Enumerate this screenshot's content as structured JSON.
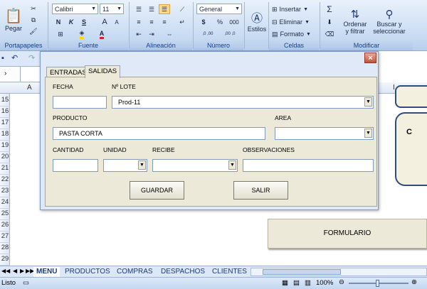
{
  "ribbon": {
    "clipboard": {
      "paste": "Pegar",
      "group": "Portapapeles"
    },
    "font": {
      "name": "Calibri",
      "size": "11",
      "bold": "N",
      "italic": "K",
      "underline": "S",
      "grow": "A",
      "shrink": "A",
      "font_color": "A",
      "group": "Fuente"
    },
    "alignment": {
      "group": "Alineación"
    },
    "number": {
      "format": "General",
      "currency": "$",
      "percent": "%",
      "thousands": "000",
      "inc_decimals": ",0 ,00",
      "dec_decimals": ",00 ,0",
      "group": "Número"
    },
    "styles": {
      "label": "Estilos"
    },
    "cells": {
      "insert": "Insertar",
      "delete": "Eliminar",
      "format": "Formato",
      "group": "Celdas"
    },
    "modify": {
      "sum": "Σ",
      "sort": "Ordenar\ny filtrar",
      "find": "Buscar y\nseleccionar",
      "group": "Modificar"
    }
  },
  "grid": {
    "column_a": "A",
    "column_i": "I",
    "rows": [
      "15",
      "16",
      "17",
      "18",
      "19",
      "20",
      "21",
      "22",
      "23",
      "24",
      "25",
      "26",
      "27",
      "28",
      "29"
    ],
    "shape_text": "FORMULARIO",
    "shape_partial": "C"
  },
  "sheet_tabs": [
    "MENU",
    "PRODUCTOS",
    "COMPRAS",
    "DESPACHOS",
    "CLIENTES"
  ],
  "status": {
    "mode": "Listo",
    "zoom": "100%"
  },
  "dialog": {
    "close": "×",
    "tabs": [
      "ENTRADAS",
      "SALIDAS"
    ],
    "fields": {
      "fecha": {
        "label": "FECHA",
        "value": ""
      },
      "lote": {
        "label": "Nº LOTE",
        "value": "Prod-11"
      },
      "producto": {
        "label": "PRODUCTO",
        "value": "PASTA CORTA"
      },
      "area": {
        "label": "AREA",
        "value": ""
      },
      "cantidad": {
        "label": "CANTIDAD",
        "value": ""
      },
      "unidad": {
        "label": "UNIDAD",
        "value": ""
      },
      "recibe": {
        "label": "RECIBE",
        "value": ""
      },
      "observaciones": {
        "label": "OBSERVACIONES",
        "value": ""
      }
    },
    "buttons": {
      "save": "GUARDAR",
      "exit": "SALIR"
    }
  }
}
